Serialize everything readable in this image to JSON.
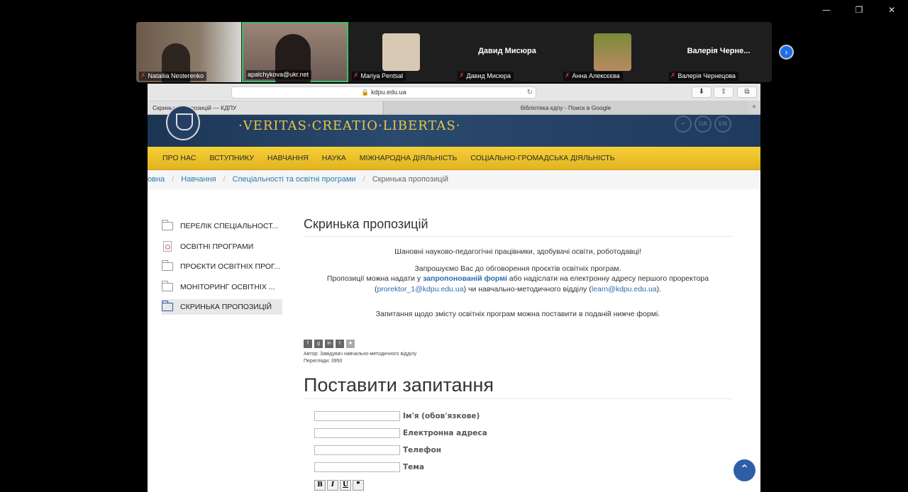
{
  "window": {
    "minimize": "—",
    "restore": "❐",
    "close": "✕"
  },
  "participants": [
    {
      "name": "Nataliia Nesterenko"
    },
    {
      "name": "apalchykova@ukr.net"
    },
    {
      "name": "Mariya Pentsal"
    },
    {
      "name": "Давид Мисюра",
      "display": "Давид Мисюра"
    },
    {
      "name": "Анна Алексєєва"
    },
    {
      "name": "Валерія Чернецова",
      "display": "Валерія  Черне..."
    }
  ],
  "browser": {
    "url": "kdpu.edu.ua",
    "tab_active": "Скринька пропозицій — КДПУ",
    "tab_other": "бібліотека кдпу - Поиск в Google"
  },
  "site": {
    "motto": "·VERITAS·CREATIO·LIBERTAS·",
    "lang_ua": "UA",
    "lang_en": "EN",
    "nav": [
      "ПРО НАС",
      "ВСТУПНИКУ",
      "НАВЧАННЯ",
      "НАУКА",
      "МІЖНАРОДНА ДІЯЛЬНІСТЬ",
      "СОЦІАЛЬНО-ГРОМАДСЬКА ДІЯЛЬНІСТЬ"
    ],
    "breadcrumb": [
      "овна",
      "Навчання",
      "Спеціальності та освітні програми",
      "Скринька пропозицій"
    ],
    "sidebar": [
      "ПЕРЕЛІК СПЕЦІАЛЬНОСТ...",
      "ОСВІТНІ ПРОГРАМИ",
      "ПРОЄКТИ ОСВІТНІХ ПРОГ...",
      "МОНІТОРИНГ ОСВІТНІХ ...",
      "СКРИНЬКА ПРОПОЗИЦІЙ"
    ]
  },
  "article": {
    "title": "Скринька пропозицій",
    "greeting": "Шановні науково-педагогічні працівники, здобувачі освіти, роботодавці!",
    "invite": "Запрошуємо Вас до обговорення проєктів освітніх програм.",
    "p2a": "Пропозиції можна надати у ",
    "p2link": "запропонованій формі",
    "p2b": " або надіслати на електронну адресу першого проректора",
    "p3a": "(",
    "email1": "prorektor_1@kdpu.edu.ua",
    "p3b": ") чи навчально-методичного відділу (",
    "email2": "learn@kdpu.edu.ua",
    "p3c": ").",
    "questions": "Запитання щодо змісту освітніх програм можна поставити в поданій нижче формі.",
    "author": "Автор: Завідувач навчально-методичного відділу",
    "views": "Перегляди: 3950"
  },
  "form": {
    "title": "Поставити запитання",
    "name_label": "Ім'я (обов'язкове)",
    "email_label": "Електронна адреса",
    "phone_label": "Телефон",
    "subject_label": "Тема",
    "bold": "B",
    "italic": "I",
    "underline": "U"
  }
}
